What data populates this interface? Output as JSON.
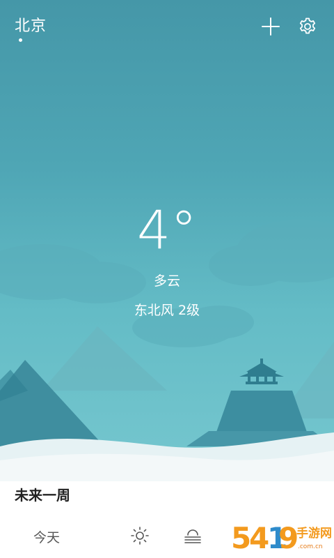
{
  "header": {
    "city": "北京"
  },
  "current": {
    "temperature": "4°",
    "condition": "多云",
    "wind": "东北风 2级"
  },
  "forecast": {
    "title": "未来一周",
    "days": [
      {
        "label": "今天",
        "day_icon": "sun-icon",
        "night_icon": "fog-icon"
      }
    ]
  },
  "watermark": {
    "text": "5419手游网",
    "url": "www.5419.com.cn"
  },
  "colors": {
    "sky_top": "#4597a8",
    "sky_bottom": "#76c7cf",
    "accent_orange": "#f39a1e"
  }
}
